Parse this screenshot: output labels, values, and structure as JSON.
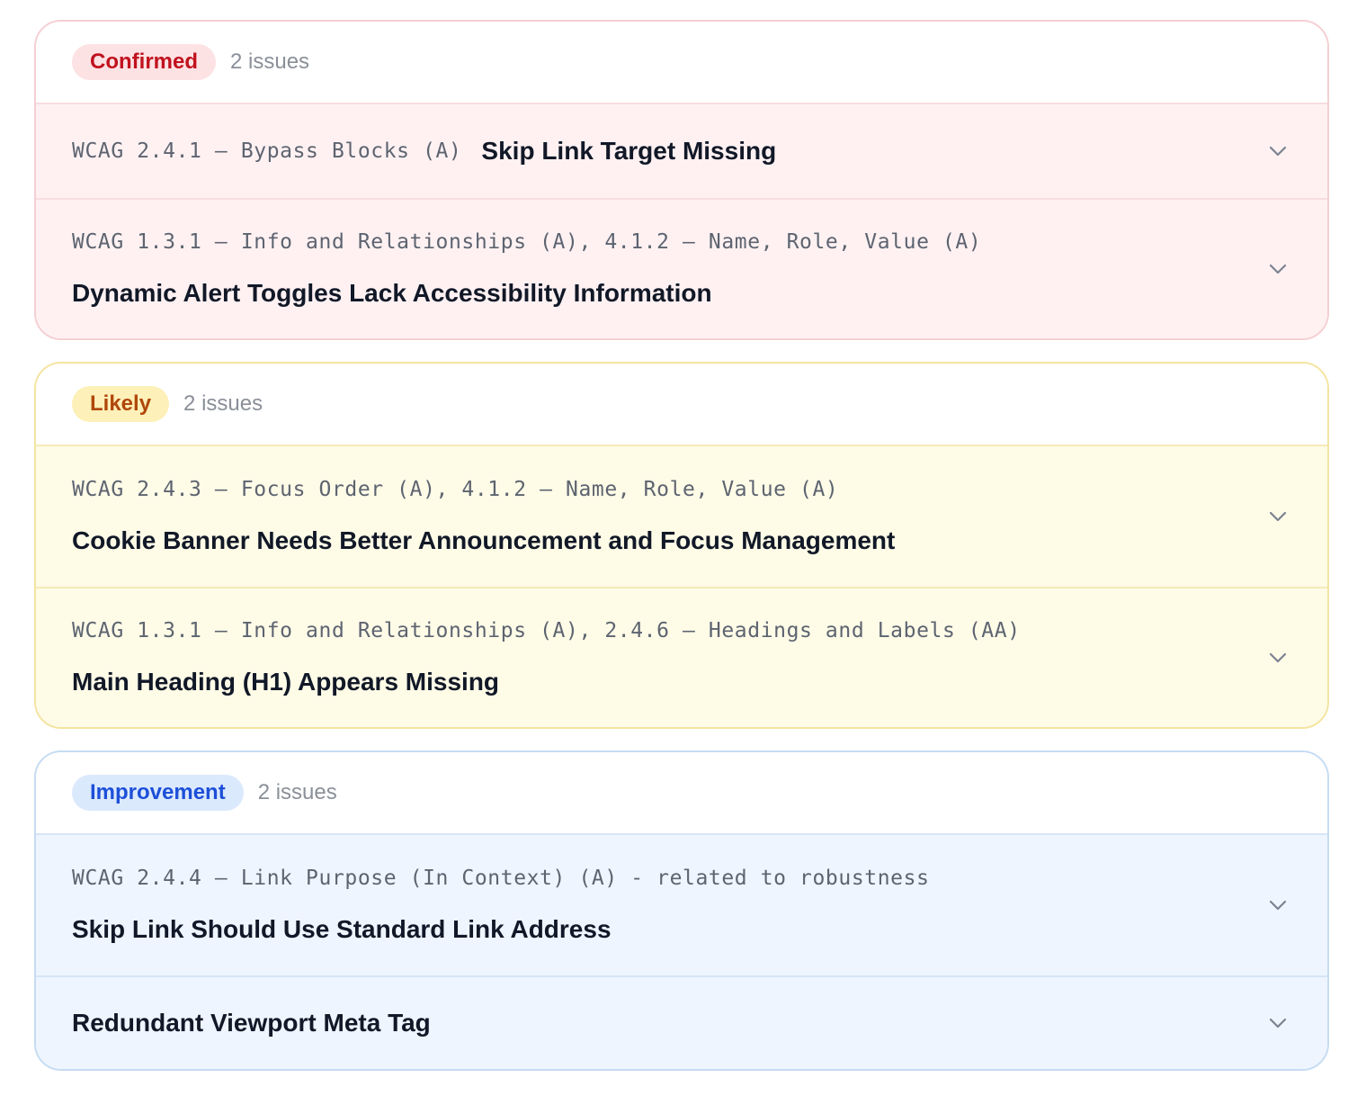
{
  "groups": [
    {
      "badge": "Confirmed",
      "count": "2 issues",
      "items": [
        {
          "criteria": "WCAG 2.4.1 — Bypass Blocks (A)",
          "title": "Skip Link Target Missing"
        },
        {
          "criteria": "WCAG 1.3.1 — Info and Relationships (A), 4.1.2 — Name, Role, Value (A)",
          "title": "Dynamic Alert Toggles Lack Accessibility Information"
        }
      ]
    },
    {
      "badge": "Likely",
      "count": "2 issues",
      "items": [
        {
          "criteria": "WCAG 2.4.3 — Focus Order (A), 4.1.2 — Name, Role, Value (A)",
          "title": "Cookie Banner Needs Better Announcement and Focus Management"
        },
        {
          "criteria": "WCAG 1.3.1 — Info and Relationships (A), 2.4.6 — Headings and Labels (AA)",
          "title": "Main Heading (H1) Appears Missing"
        }
      ]
    },
    {
      "badge": "Improvement",
      "count": "2 issues",
      "items": [
        {
          "criteria": "WCAG 2.4.4 — Link Purpose (In Context) (A) - related to robustness",
          "title": "Skip Link Should Use Standard Link Address"
        },
        {
          "title": "Redundant Viewport Meta Tag"
        }
      ]
    }
  ],
  "colors": {
    "confirmed_text": "#c0121e",
    "likely_text": "#b0470a",
    "improvement_text": "#1d4fd8"
  },
  "icons": {
    "expand": "chevron-down-icon"
  }
}
